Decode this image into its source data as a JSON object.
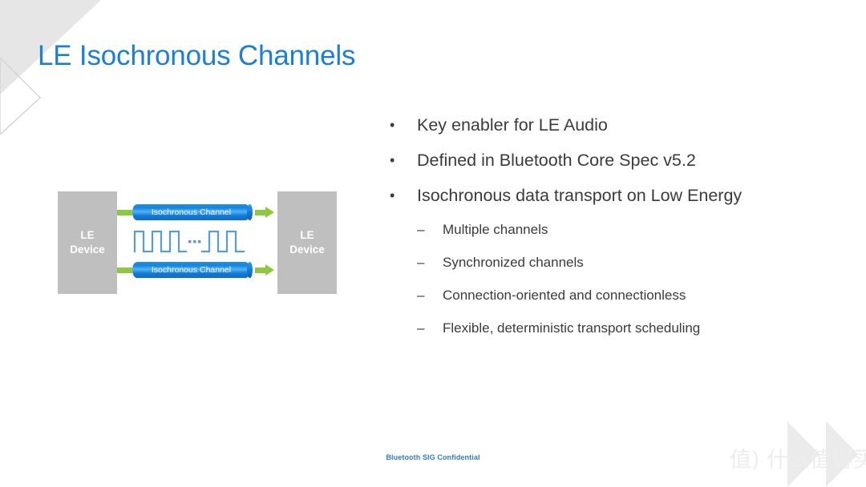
{
  "slide": {
    "title": "LE Isochronous Channels",
    "title_color": "#1d7fd2",
    "background": "#ffffff"
  },
  "diagram": {
    "left_device": {
      "line1": "LE",
      "line2": "Device"
    },
    "right_device": {
      "line1": "LE",
      "line2": "Device"
    },
    "channels": [
      {
        "label": "Isochronous Channel",
        "position": "top"
      },
      {
        "label": "Isochronous Channel",
        "position": "bottom"
      }
    ],
    "waveform": {
      "name": "square-wave",
      "left_pulses": 3,
      "right_pulses": 2,
      "ellipsis": "...",
      "color": "#5b9bd5"
    },
    "colors": {
      "device_box": "#bfbfbf",
      "device_text": "#ffffff",
      "channel_blue": "#1683dd",
      "arrow_green": "#8fc642"
    }
  },
  "bullets": [
    {
      "level": 1,
      "marker": "•",
      "text": "Key enabler for LE Audio"
    },
    {
      "level": 1,
      "marker": "•",
      "text": "Defined in Bluetooth Core Spec v5.2"
    },
    {
      "level": 1,
      "marker": "•",
      "text": "Isochronous data transport on Low Energy"
    },
    {
      "level": 2,
      "marker": "–",
      "text": "Multiple channels"
    },
    {
      "level": 2,
      "marker": "–",
      "text": "Synchronized channels"
    },
    {
      "level": 2,
      "marker": "–",
      "text": "Connection-oriented and connectionless"
    },
    {
      "level": 2,
      "marker": "–",
      "text": "Flexible, deterministic transport scheduling"
    }
  ],
  "footer": {
    "text": "Bluetooth SIG Confidential",
    "color": "#2f7fc4"
  },
  "watermark": {
    "text": "值) 什么值得买",
    "color": "#ededed"
  }
}
